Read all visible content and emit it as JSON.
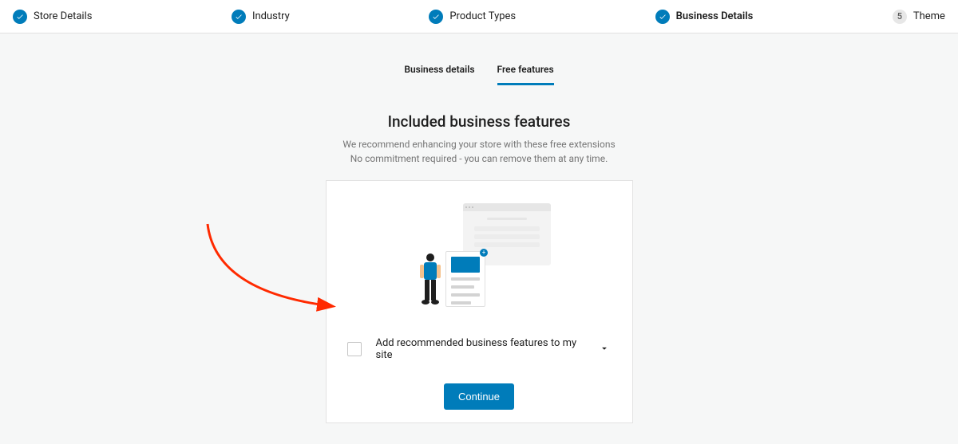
{
  "stepper": {
    "steps": [
      {
        "label": "Store Details",
        "state": "done"
      },
      {
        "label": "Industry",
        "state": "done"
      },
      {
        "label": "Product Types",
        "state": "done"
      },
      {
        "label": "Business Details",
        "state": "done",
        "bold": true
      },
      {
        "label": "Theme",
        "state": "num",
        "num": "5"
      }
    ]
  },
  "tabs": {
    "business_details": "Business details",
    "free_features": "Free features"
  },
  "heading": {
    "title": "Included business features",
    "subtitle_line1": "We recommend enhancing your store with these free extensions",
    "subtitle_line2": "No commitment required - you can remove them at any time."
  },
  "checkbox": {
    "label": "Add recommended business features to my site"
  },
  "continue_label": "Continue"
}
